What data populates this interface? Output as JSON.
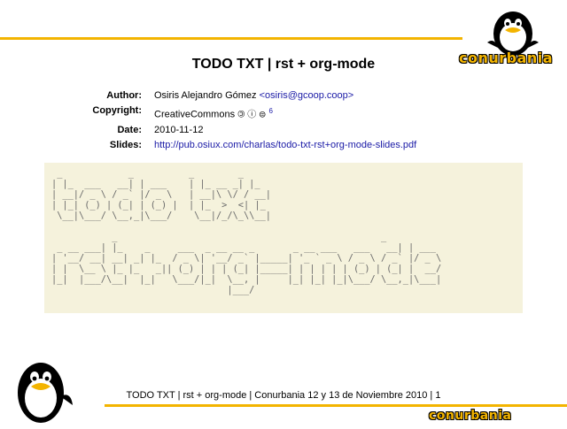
{
  "slide": {
    "title": "TODO TXT | rst + org-mode",
    "meta": [
      {
        "key": "Author:",
        "value": "Osiris Alejandro Gómez ",
        "link": "<osiris@gcoop.coop>"
      },
      {
        "key": "Copyright:",
        "value": "CreativeCommons ",
        "icons": "🄯 ⓘ ⊜",
        "sup": "6"
      },
      {
        "key": "Date:",
        "value": "2010-11-12"
      },
      {
        "key": "Slides:",
        "link": "http://pub.osiux.com/charlas/todo-txt-rst+org-mode-slides.pdf"
      }
    ],
    "ascii_art": " _            _          _        _\n| |_  ___   __| | ___    | |_ __ _| |_\n| __|/ _ \\ / _` |/ _ \\   | __|\\ \\/ / __|\n| |_| (_) | (_| | (_) |  | |_  >  <| |_\n \\__|\\___/ \\__,_|\\___/    \\__|/_/\\_\\\\__|\n\n           _                                                _\n _ __ ___| |_    _     ___  _ __ __ _       _ __ ___   ___   __| | ___\n| '__/ __| __| _| |_  / _ \\| '__/ _` |_____| '_ ` _ \\ / _ \\ / _` |/ _ \\\n| |  \\__ \\ |_ |_   _|| (_) | | | (_| |_____| | | | | | (_) | (_| |  __/\n|_|  |___/\\__|  |_|   \\___/|_|  \\__, |     |_| |_| |_|\\___/ \\__,_|\\___|\n                                |___/",
    "footer": "TODO TXT | rst + org-mode | Conurbania 12 y 13 de Noviembre 2010 | 1",
    "brand": "conurbania"
  },
  "colors": {
    "accent": "#f3b400",
    "link": "#1a1aa6",
    "ascii_bg": "#f5f2dc"
  },
  "icons": [
    "tux-penguin-logo-top",
    "tux-penguin-logo-bottom",
    "creative-commons-icons"
  ]
}
